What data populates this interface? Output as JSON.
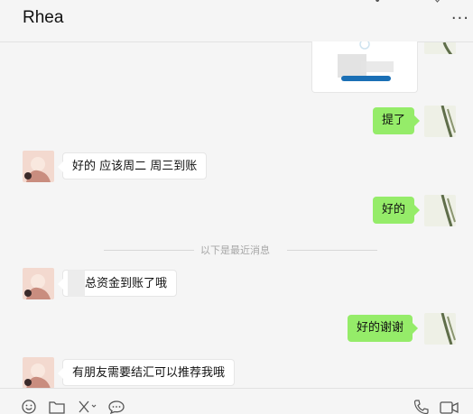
{
  "chat": {
    "contact_name": "Rhea",
    "more_icon": "more-dots-icon",
    "messages": [
      {
        "side": "right",
        "type": "image"
      },
      {
        "side": "right",
        "text": "提了"
      },
      {
        "side": "left",
        "text": "好的 应该周二 周三到账"
      },
      {
        "side": "right",
        "text": "好的"
      },
      {
        "side": "left",
        "text": "总资金到账了哦"
      },
      {
        "side": "right",
        "text": "好的谢谢"
      },
      {
        "side": "left",
        "text": "有朋友需要结汇可以推荐我哦"
      }
    ],
    "divider": "以下是最近消息"
  },
  "toolbar": {
    "icons": [
      "emoji-icon",
      "folder-icon",
      "scissors-icon",
      "chat-history-icon",
      "phone-icon",
      "video-call-icon"
    ]
  },
  "colors": {
    "background": "#f5f5f5",
    "outgoing_bubble": "#95ec69",
    "incoming_bubble": "#ffffff",
    "divider_text": "#a6a6a6"
  }
}
